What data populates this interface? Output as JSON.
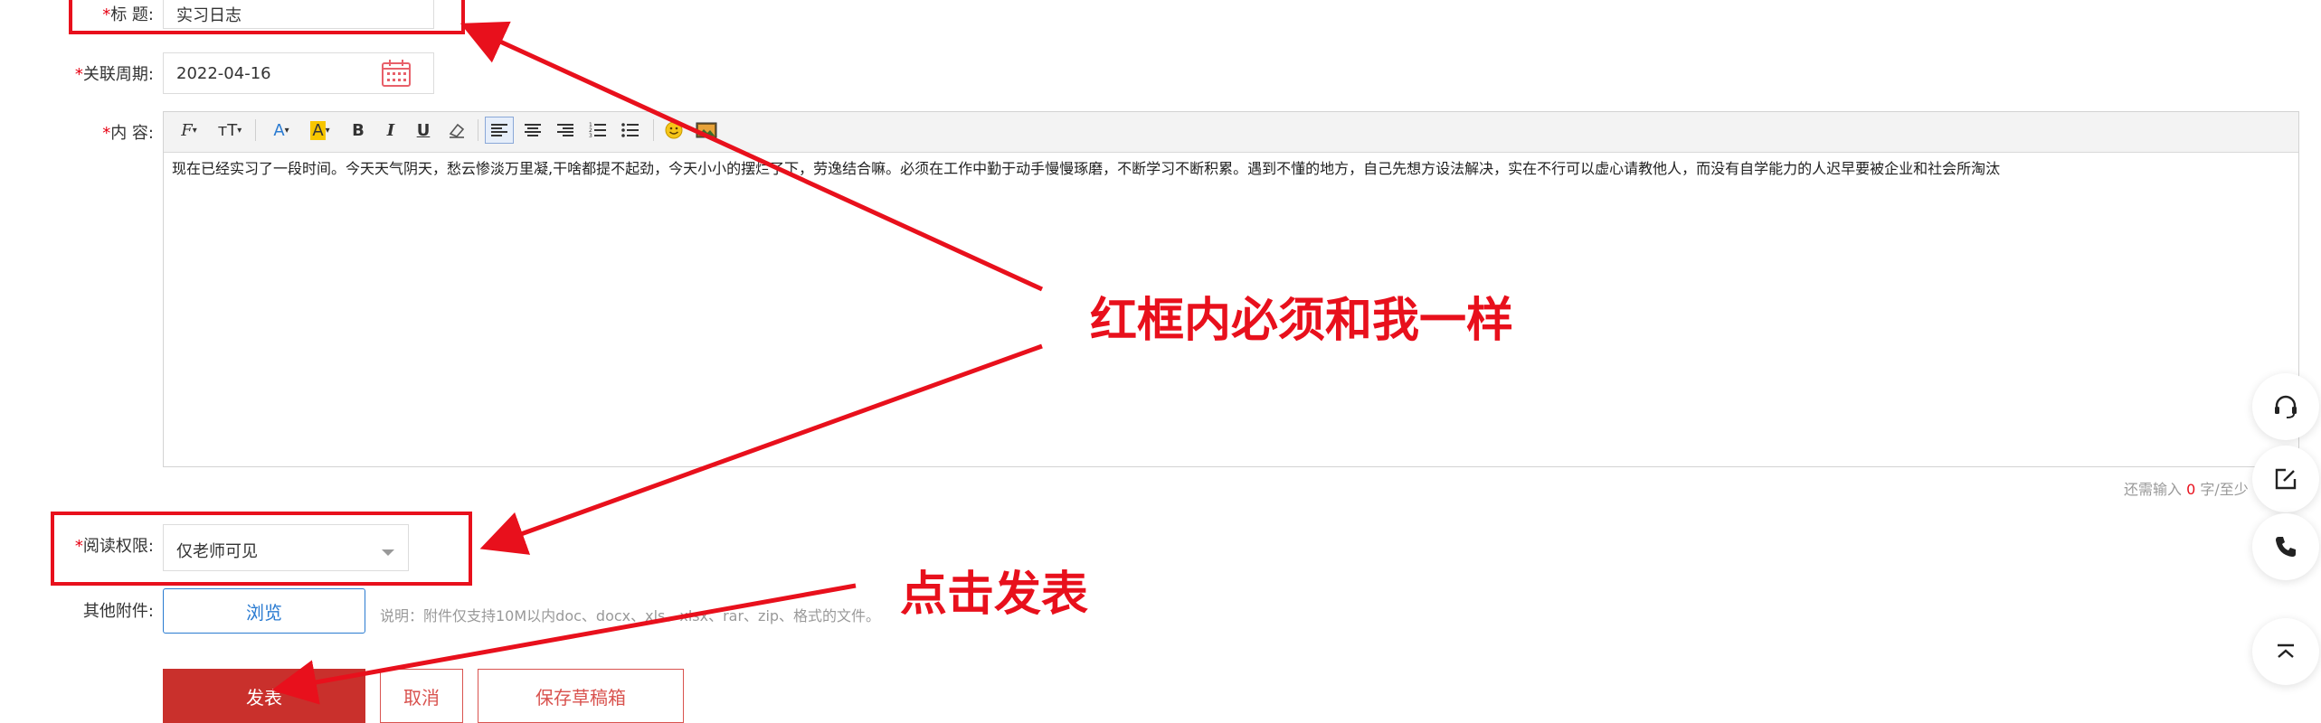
{
  "form": {
    "title": {
      "required": "*",
      "label": "标 题:",
      "value": "实习日志"
    },
    "period": {
      "required": "*",
      "label": "关联周期:",
      "value": "2022-04-16"
    },
    "content": {
      "required": "*",
      "label": "内 容:",
      "text": "现在已经实习了一段时间。今天天气阴天，愁云惨淡万里凝,干啥都提不起劲，今天小小的摆烂了下，劳逸结合嘛。必须在工作中勤于动手慢慢琢磨，不断学习不断积累。遇到不懂的地方，自己先想方设法解决，实在不行可以虚心请教他人，而没有自学能力的人迟早要被企业和社会所淘汰",
      "counter_prefix": "还需输入",
      "counter_value": "0",
      "counter_suffix": "字/至少"
    },
    "permission": {
      "required": "*",
      "label": "阅读权限:",
      "value": "仅老师可见"
    },
    "attachment": {
      "label": "其他附件:",
      "browse": "浏览",
      "note": "说明：附件仅支持10M以内doc、docx、xls、xlsx、rar、zip、格式的文件。"
    }
  },
  "toolbar": {
    "font": "F",
    "size": "тT",
    "color": "A",
    "bg": "A",
    "bold": "B",
    "italic": "I",
    "underline": "U"
  },
  "actions": {
    "publish": "发表",
    "cancel": "取消",
    "draft": "保存草稿箱"
  },
  "annotations": {
    "must_match": "红框内必须和我一样",
    "click_publish": "点击发表"
  },
  "colors": {
    "accent": "#e8101c",
    "publish_bg": "#c9302c",
    "link_blue": "#2a7bd1"
  }
}
